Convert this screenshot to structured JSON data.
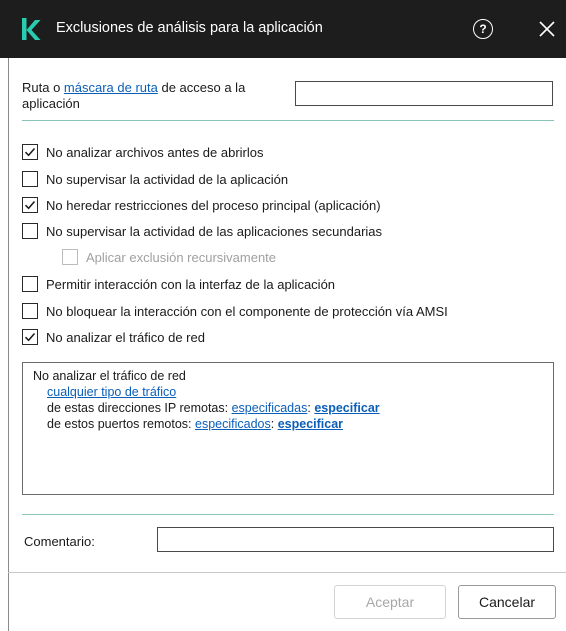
{
  "dialog": {
    "title": "Exclusiones de análisis para la aplicación"
  },
  "path": {
    "label_prefix": "Ruta o ",
    "label_link": "máscara de ruta",
    "label_suffix": " de acceso a la aplicación",
    "value": ""
  },
  "options": [
    {
      "label": "No analizar archivos antes de abrirlos",
      "checked": true
    },
    {
      "label": "No supervisar la actividad de la aplicación",
      "checked": false
    },
    {
      "label": "No heredar restricciones del proceso principal (aplicación)",
      "checked": true
    },
    {
      "label": "No supervisar la actividad de las aplicaciones secundarias",
      "checked": false
    },
    {
      "label": "Aplicar exclusión recursivamente",
      "checked": false,
      "disabled": true
    },
    {
      "label": "Permitir interacción con la interfaz de la aplicación",
      "checked": false
    },
    {
      "label": "No bloquear la interacción con el componente de protección vía AMSI",
      "checked": false
    },
    {
      "label": "No analizar el tráfico de red",
      "checked": true
    }
  ],
  "traffic": {
    "heading": "No analizar el tráfico de red",
    "type_link": "cualquier tipo de tráfico",
    "ip_prefix": "de estas direcciones IP remotas: ",
    "ip_value_link": "especificadas",
    "colon": ":",
    "specify_link": "especificar",
    "ports_prefix": "de estos puertos remotos: ",
    "ports_value_link": "especificados"
  },
  "comment": {
    "label": "Comentario:",
    "value": ""
  },
  "buttons": {
    "accept": "Aceptar",
    "cancel": "Cancelar"
  },
  "colors": {
    "titlebar": "#1d1d1d",
    "brand": "#29ccb1",
    "link": "#0b5fb8",
    "separator": "#8ac4b8"
  }
}
